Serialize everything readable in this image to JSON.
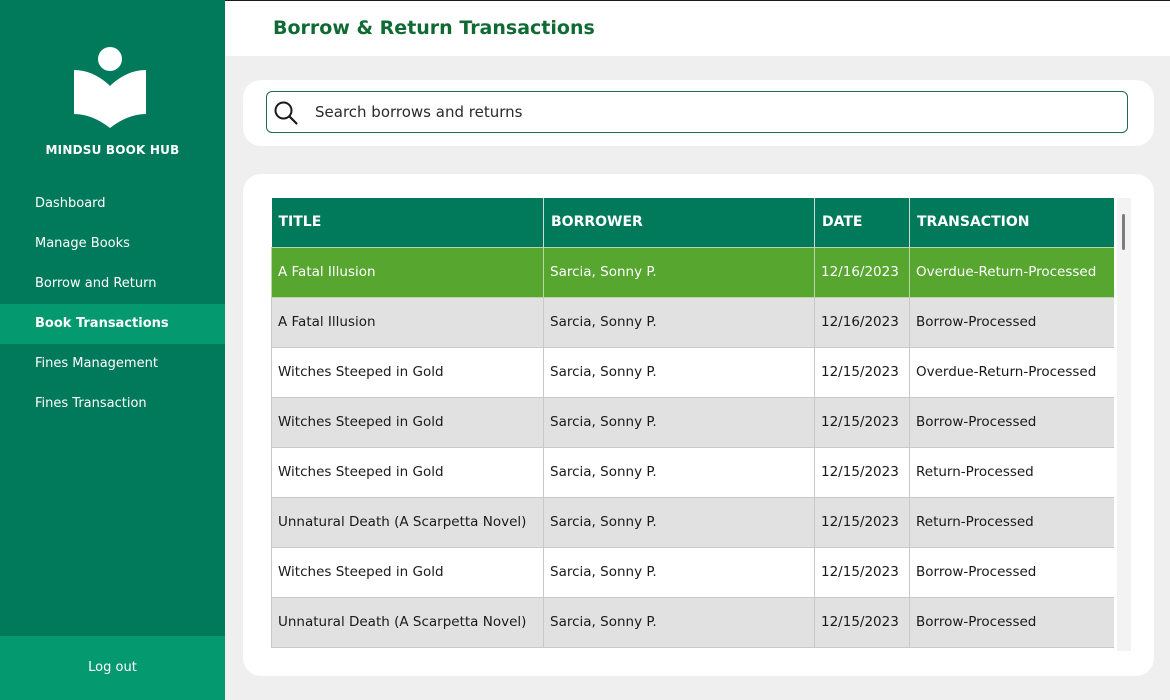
{
  "app": {
    "brand": "MINDSU BOOK HUB",
    "logo_icon": "book-reader-icon"
  },
  "sidebar": {
    "items": [
      {
        "label": "Dashboard"
      },
      {
        "label": "Manage Books"
      },
      {
        "label": "Borrow and Return"
      },
      {
        "label": "Book Transactions",
        "active": true
      },
      {
        "label": "Fines Management"
      },
      {
        "label": "Fines Transaction"
      }
    ],
    "logout_label": "Log out"
  },
  "header": {
    "title": "Borrow & Return Transactions"
  },
  "search": {
    "placeholder": "Search borrows and returns",
    "value": "",
    "icon": "search-icon"
  },
  "table": {
    "columns": [
      "TITLE",
      "BORROWER",
      "DATE",
      "TRANSACTION"
    ],
    "rows": [
      [
        "A Fatal Illusion",
        "Sarcia, Sonny P.",
        "12/16/2023",
        "Overdue-Return-Processed"
      ],
      [
        "A Fatal Illusion",
        "Sarcia, Sonny P.",
        "12/16/2023",
        "Borrow-Processed"
      ],
      [
        "Witches Steeped in Gold",
        "Sarcia, Sonny P.",
        "12/15/2023",
        "Overdue-Return-Processed"
      ],
      [
        "Witches Steeped in Gold",
        "Sarcia, Sonny P.",
        "12/15/2023",
        "Borrow-Processed"
      ],
      [
        "Witches Steeped in Gold",
        "Sarcia, Sonny P.",
        "12/15/2023",
        "Return-Processed"
      ],
      [
        "Unnatural Death (A Scarpetta Novel)",
        "Sarcia, Sonny P.",
        "12/15/2023",
        "Return-Processed"
      ],
      [
        "Witches Steeped in Gold",
        "Sarcia, Sonny P.",
        "12/15/2023",
        "Borrow-Processed"
      ],
      [
        "Unnatural Death (A Scarpetta Novel)",
        "Sarcia, Sonny P.",
        "12/15/2023",
        "Borrow-Processed"
      ]
    ],
    "selected_row": 0
  },
  "colors": {
    "sidebar": "#017a5c",
    "sidebar_active": "#04996f",
    "header_title": "#0f6a34",
    "selected_row": "#56a630",
    "row_alt": "#e1e1e1"
  }
}
